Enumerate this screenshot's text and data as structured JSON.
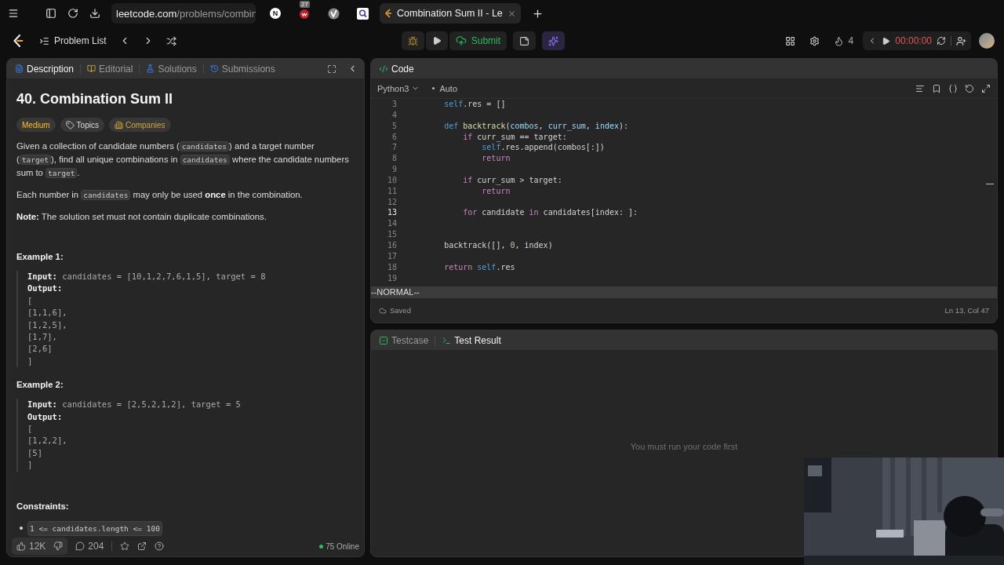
{
  "browser": {
    "url": {
      "host": "leetcode.com",
      "path": "/problems/combin"
    },
    "extensions": [
      {
        "kind": "letter",
        "label": "N"
      },
      {
        "kind": "badge",
        "badge": "27"
      },
      {
        "kind": "logo"
      },
      {
        "kind": "search"
      }
    ],
    "tab": {
      "title": "Combination Sum II - Le"
    }
  },
  "toolbar": {
    "problem_list": "Problem List",
    "submit": "Submit",
    "streak": "4",
    "timer": "00:00:00"
  },
  "description_panel": {
    "tabs": [
      {
        "label": "Description",
        "selected": true
      },
      {
        "label": "Editorial",
        "selected": false
      },
      {
        "label": "Solutions",
        "selected": false
      },
      {
        "label": "Submissions",
        "selected": false
      }
    ],
    "title": "40. Combination Sum II",
    "tags": [
      {
        "kind": "difficulty",
        "label": "Medium"
      },
      {
        "kind": "topics",
        "label": "Topics"
      },
      {
        "kind": "companies",
        "label": "Companies"
      }
    ],
    "paragraphs": [
      [
        {
          "kind": "text",
          "text": "Given a collection of candidate numbers ("
        },
        {
          "kind": "code",
          "text": "candidates"
        },
        {
          "kind": "text",
          "text": ") and a target number ("
        },
        {
          "kind": "code",
          "text": "target"
        },
        {
          "kind": "text",
          "text": "), find all unique combinations in "
        },
        {
          "kind": "code",
          "text": "candidates"
        },
        {
          "kind": "text",
          "text": " where the candidate numbers sum to "
        },
        {
          "kind": "code",
          "text": "target"
        },
        {
          "kind": "text",
          "text": "."
        }
      ],
      [
        {
          "kind": "text",
          "text": "Each number in "
        },
        {
          "kind": "code",
          "text": "candidates"
        },
        {
          "kind": "text",
          "text": " may only be used "
        },
        {
          "kind": "bold",
          "text": "once"
        },
        {
          "kind": "text",
          "text": " in the combination."
        }
      ],
      [
        {
          "kind": "bold",
          "text": "Note:"
        },
        {
          "kind": "text",
          "text": " The solution set must not contain duplicate combinations."
        }
      ]
    ],
    "examples": [
      {
        "title": "Example 1:",
        "input_label": "Input:",
        "input": "candidates = [10,1,2,7,6,1,5], target = 8",
        "output_label": "Output:",
        "output_lines": [
          "[",
          "[1,1,6],",
          "[1,2,5],",
          "[1,7],",
          "[2,6]",
          "]"
        ]
      },
      {
        "title": "Example 2:",
        "input_label": "Input:",
        "input": "candidates = [2,5,2,1,2], target = 5",
        "output_label": "Output:",
        "output_lines": [
          "[",
          "[1,2,2],",
          "[5]",
          "]"
        ]
      }
    ],
    "constraints_title": "Constraints:",
    "constraints": [
      "1 <= candidates.length <= 100"
    ],
    "footer": {
      "likes": "12K",
      "comments": "204",
      "online": "75 Online"
    }
  },
  "code_panel": {
    "title": "Code",
    "language": "Python3",
    "mode": "Auto",
    "lines": [
      {
        "number": "3",
        "current": false,
        "tokens": [
          {
            "kind": "self",
            "text": "        self"
          },
          {
            "kind": "plain",
            "text": ".res = []"
          }
        ]
      },
      {
        "number": "4",
        "current": false
      },
      {
        "number": "5",
        "current": false,
        "tokens": [
          {
            "kind": "declaration",
            "text": "        def "
          },
          {
            "kind": "function",
            "text": "backtrack"
          },
          {
            "kind": "plain",
            "text": "("
          },
          {
            "kind": "parameter",
            "text": "combos"
          },
          {
            "kind": "plain",
            "text": ", "
          },
          {
            "kind": "parameter",
            "text": "curr_sum"
          },
          {
            "kind": "plain",
            "text": ", "
          },
          {
            "kind": "parameter",
            "text": "index"
          },
          {
            "kind": "plain",
            "text": "):"
          }
        ]
      },
      {
        "number": "6",
        "current": false,
        "tokens": [
          {
            "kind": "keyword",
            "text": "            if"
          },
          {
            "kind": "plain",
            "text": " curr_sum == target:"
          }
        ]
      },
      {
        "number": "7",
        "current": false,
        "tokens": [
          {
            "kind": "self",
            "text": "                self"
          },
          {
            "kind": "plain",
            "text": ".res.append(combos[:])"
          }
        ]
      },
      {
        "number": "8",
        "current": false,
        "tokens": [
          {
            "kind": "keyword",
            "text": "                return"
          }
        ]
      },
      {
        "number": "9",
        "current": false
      },
      {
        "number": "10",
        "current": false,
        "tokens": [
          {
            "kind": "keyword",
            "text": "            if"
          },
          {
            "kind": "plain",
            "text": " curr_sum > target:"
          }
        ]
      },
      {
        "number": "11",
        "current": false,
        "tokens": [
          {
            "kind": "keyword",
            "text": "                return"
          }
        ]
      },
      {
        "number": "12",
        "current": false
      },
      {
        "number": "13",
        "current": true,
        "tokens": [
          {
            "kind": "keyword",
            "text": "            for"
          },
          {
            "kind": "plain",
            "text": " candidate "
          },
          {
            "kind": "keyword",
            "text": "in"
          },
          {
            "kind": "plain",
            "text": " candidates[index: ]:"
          }
        ]
      },
      {
        "number": "14",
        "current": false
      },
      {
        "number": "15",
        "current": false
      },
      {
        "number": "16",
        "current": false,
        "tokens": [
          {
            "kind": "plain",
            "text": "        backtrack([], "
          },
          {
            "kind": "number",
            "text": "0"
          },
          {
            "kind": "plain",
            "text": ", index)"
          }
        ]
      },
      {
        "number": "17",
        "current": false
      },
      {
        "number": "18",
        "current": false,
        "tokens": [
          {
            "kind": "keyword",
            "text": "        return "
          },
          {
            "kind": "self",
            "text": "self"
          },
          {
            "kind": "plain",
            "text": ".res"
          }
        ]
      },
      {
        "number": "19",
        "current": false
      }
    ],
    "vim_mode": "--NORMAL--",
    "save_status": "Saved",
    "cursor": "Ln 13, Col 47"
  },
  "result_panel": {
    "tabs": [
      {
        "label": "Testcase",
        "selected": false
      },
      {
        "label": "Test Result",
        "selected": true
      }
    ],
    "message": "You must run your code first"
  }
}
